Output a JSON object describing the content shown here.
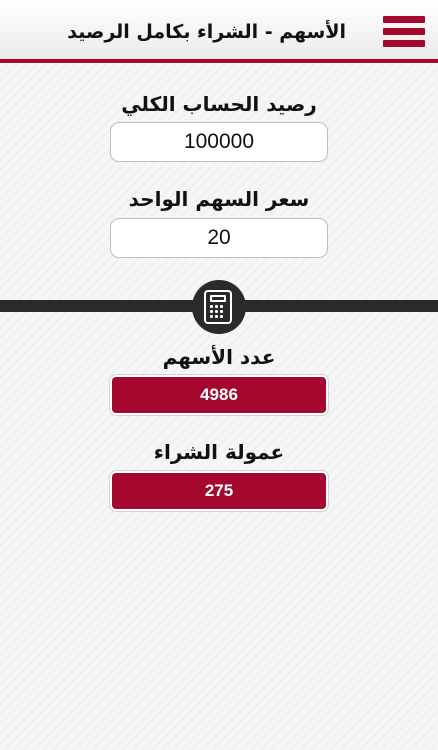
{
  "header": {
    "title": "الأسهم - الشراء بكامل الرصيد",
    "menu_icon": "hamburger-menu-icon",
    "accent_color": "#a4082d"
  },
  "form": {
    "balance_label": "رصيد الحساب الكلي",
    "balance_value": "100000",
    "price_label": "سعر السهم الواحد",
    "price_value": "20"
  },
  "divider": {
    "icon": "calculator-icon"
  },
  "results": {
    "shares_label": "عدد الأسهم",
    "shares_value": "4986",
    "commission_label": "عمولة الشراء",
    "commission_value": "275"
  }
}
